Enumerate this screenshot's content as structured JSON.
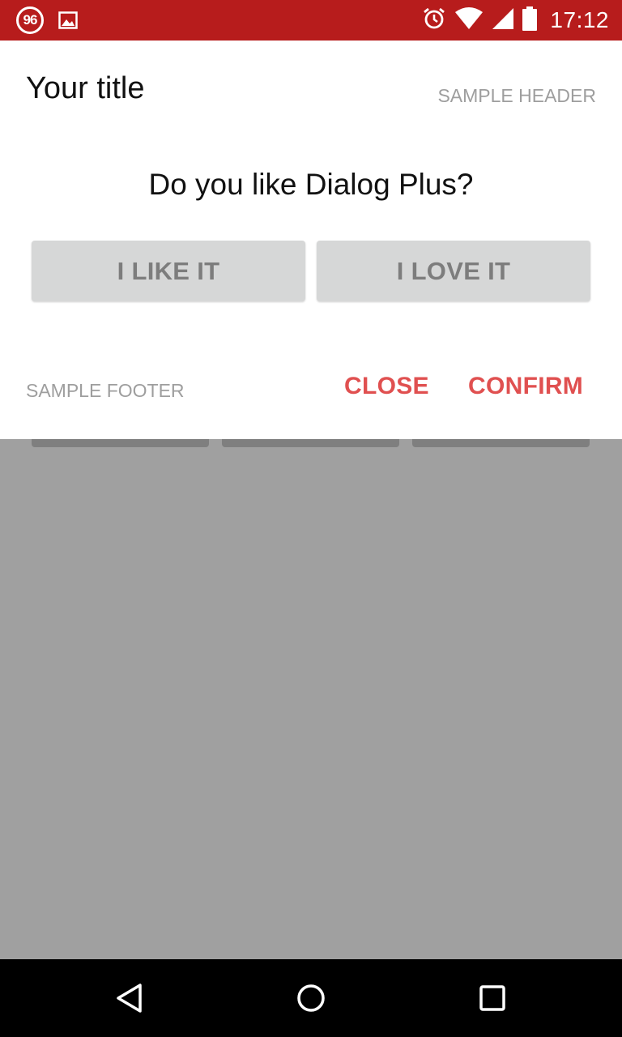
{
  "status_bar": {
    "notification_badge": "96",
    "icons": [
      "badge-96-icon",
      "image-icon",
      "alarm-icon",
      "wifi-icon",
      "signal-icon",
      "battery-icon"
    ],
    "time": "17:12",
    "color": "#b71c1c"
  },
  "dialog": {
    "title": "Your title",
    "header": "SAMPLE HEADER",
    "question": "Do you like Dialog Plus?",
    "options": [
      {
        "label": "I LIKE IT"
      },
      {
        "label": "I LOVE IT"
      }
    ],
    "footer": "SAMPLE FOOTER",
    "actions": {
      "close": "CLOSE",
      "confirm": "CONFIRM"
    },
    "accent_color": "#e05050"
  },
  "nav_bar": {
    "icons": [
      "back-icon",
      "home-icon",
      "recents-icon"
    ]
  }
}
